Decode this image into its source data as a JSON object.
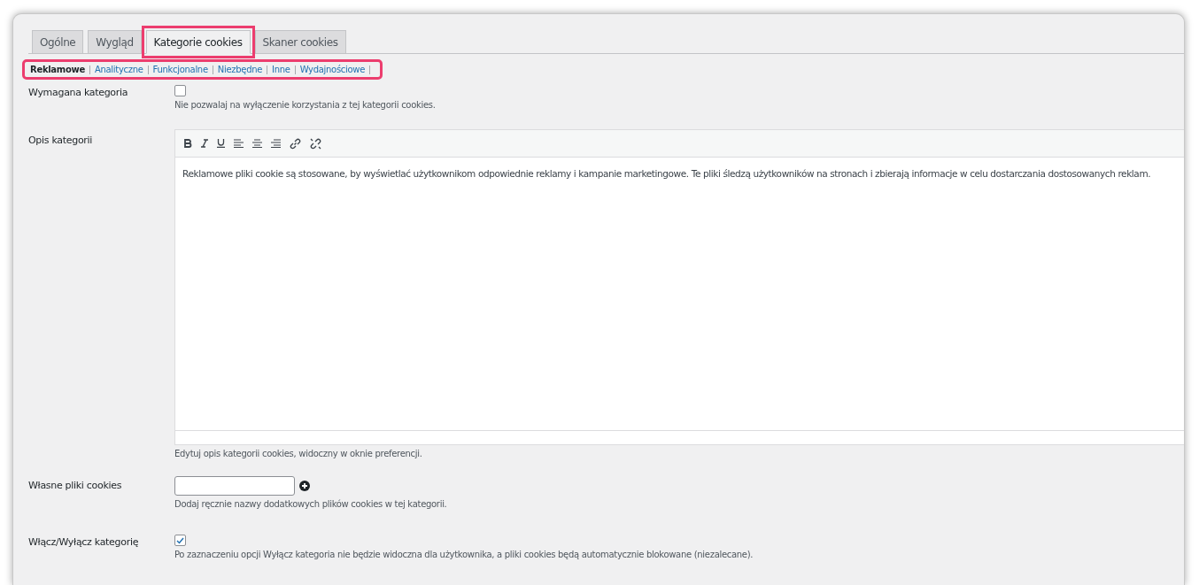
{
  "tabs": [
    {
      "label": "Ogólne",
      "selected": false,
      "highlighted": false
    },
    {
      "label": "Wygląd",
      "selected": false,
      "highlighted": false
    },
    {
      "label": "Kategorie cookies",
      "selected": true,
      "highlighted": true
    },
    {
      "label": "Skaner cookies",
      "selected": false,
      "highlighted": false
    }
  ],
  "subnav": {
    "highlighted": true,
    "items": [
      {
        "label": "Reklamowe",
        "selected": true
      },
      {
        "label": "Analityczne",
        "selected": false
      },
      {
        "label": "Funkcjonalne",
        "selected": false
      },
      {
        "label": "Niezbędne",
        "selected": false
      },
      {
        "label": "Inne",
        "selected": false
      },
      {
        "label": "Wydajnościowe",
        "selected": false
      }
    ]
  },
  "fields": [
    {
      "kind": "checkbox",
      "label": "Wymagana kategoria",
      "checked": false,
      "help": "Nie pozwalaj na wyłączenie korzystania z tej kategorii cookies."
    },
    {
      "kind": "editor",
      "label": "Opis kategorii",
      "content": "Reklamowe pliki cookie są stosowane, by wyświetlać użytkownikom odpowiednie reklamy i kampanie marketingowe. Te pliki śledzą użytkowników na stronach i zbierają informacje w celu dostarczania dostosowanych reklam.",
      "help": "Edytuj opis kategorii cookies, widoczny w oknie preferencji."
    },
    {
      "kind": "text_input",
      "label": "Własne pliki cookies",
      "help": "Dodaj ręcznie nazwy dodatkowych plików cookies w tej kategorii."
    },
    {
      "kind": "checkbox",
      "label": "Włącz/Wyłącz kategorię",
      "checked": true,
      "help": "Po zaznaczeniu opcji Wyłącz kategoria nie będzie widoczna dla użytkownika, a pliki cookies będą automatycznie blokowane (niezalecane)."
    }
  ]
}
